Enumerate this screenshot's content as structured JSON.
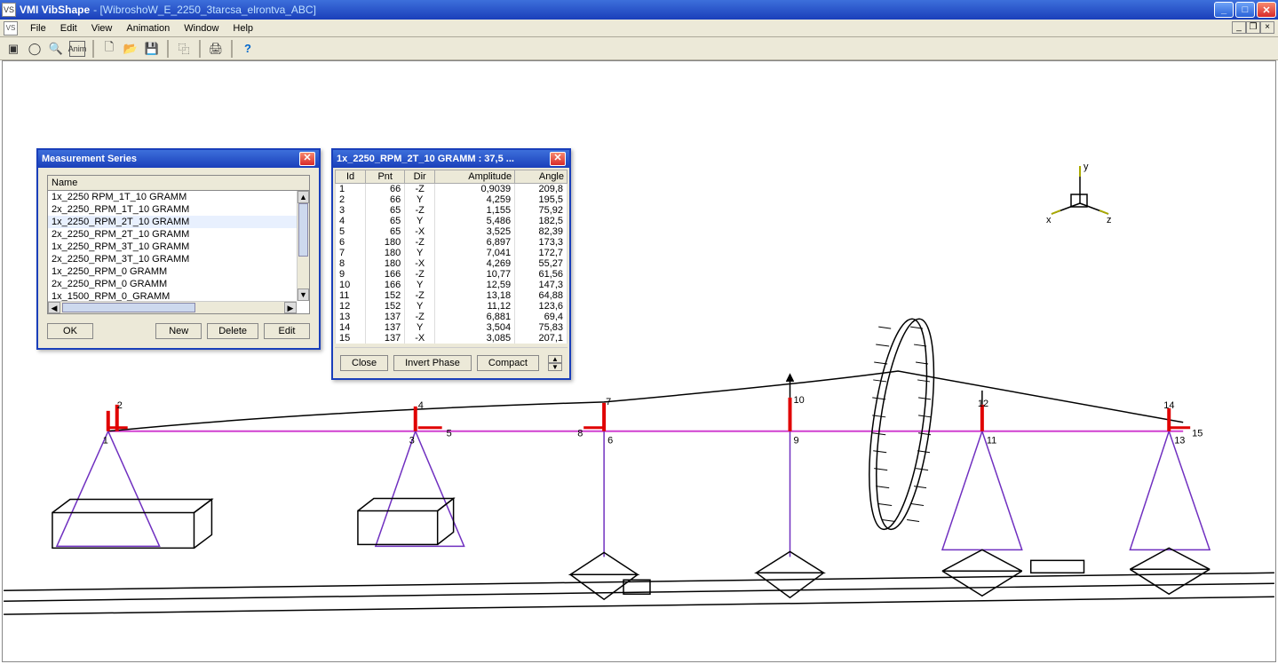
{
  "title": {
    "app": "VMI VibShape",
    "doc": "- [WibroshoW_E_2250_3tarcsa_elrontva_ABC]"
  },
  "menu": [
    "File",
    "Edit",
    "View",
    "Animation",
    "Window",
    "Help"
  ],
  "meas": {
    "title": "Measurement Series",
    "header": "Name",
    "items": [
      "1x_2250 RPM_1T_10 GRAMM",
      "2x_2250_RPM_1T_10 GRAMM",
      "1x_2250_RPM_2T_10 GRAMM",
      "2x_2250_RPM_2T_10 GRAMM",
      "1x_2250_RPM_3T_10 GRAMM",
      "2x_2250_RPM_3T_10 GRAMM",
      "1x_2250_RPM_0 GRAMM",
      "2x_2250_RPM_0 GRAMM",
      "1x_1500_RPM_0_GRAMM"
    ],
    "selected": 2,
    "btns": {
      "ok": "OK",
      "new": "New",
      "delete": "Delete",
      "edit": "Edit"
    }
  },
  "data": {
    "title": "1x_2250_RPM_2T_10 GRAMM : 37,5 ...",
    "cols": [
      "Id",
      "Pnt",
      "Dir",
      "Amplitude",
      "Angle"
    ],
    "rows": [
      [
        "1",
        "66",
        "-Z",
        "0,9039",
        "209,8"
      ],
      [
        "2",
        "66",
        "Y",
        "4,259",
        "195,5"
      ],
      [
        "3",
        "65",
        "-Z",
        "1,155",
        "75,92"
      ],
      [
        "4",
        "65",
        "Y",
        "5,486",
        "182,5"
      ],
      [
        "5",
        "65",
        "-X",
        "3,525",
        "82,39"
      ],
      [
        "6",
        "180",
        "-Z",
        "6,897",
        "173,3"
      ],
      [
        "7",
        "180",
        "Y",
        "7,041",
        "172,7"
      ],
      [
        "8",
        "180",
        "-X",
        "4,269",
        "55,27"
      ],
      [
        "9",
        "166",
        "-Z",
        "10,77",
        "61,56"
      ],
      [
        "10",
        "166",
        "Y",
        "12,59",
        "147,3"
      ],
      [
        "11",
        "152",
        "-Z",
        "13,18",
        "64,88"
      ],
      [
        "12",
        "152",
        "Y",
        "11,12",
        "123,6"
      ],
      [
        "13",
        "137",
        "-Z",
        "6,881",
        "69,4"
      ],
      [
        "14",
        "137",
        "Y",
        "3,504",
        "75,83"
      ],
      [
        "15",
        "137",
        "-X",
        "3,085",
        "207,1"
      ]
    ],
    "btns": {
      "close": "Close",
      "invert": "Invert Phase",
      "compact": "Compact"
    }
  },
  "axis": {
    "x": "x",
    "y": "y",
    "z": "z"
  },
  "nodes": [
    "1",
    "2",
    "3",
    "4",
    "5",
    "6",
    "7",
    "8",
    "9",
    "10",
    "11",
    "12",
    "13",
    "14",
    "15"
  ]
}
